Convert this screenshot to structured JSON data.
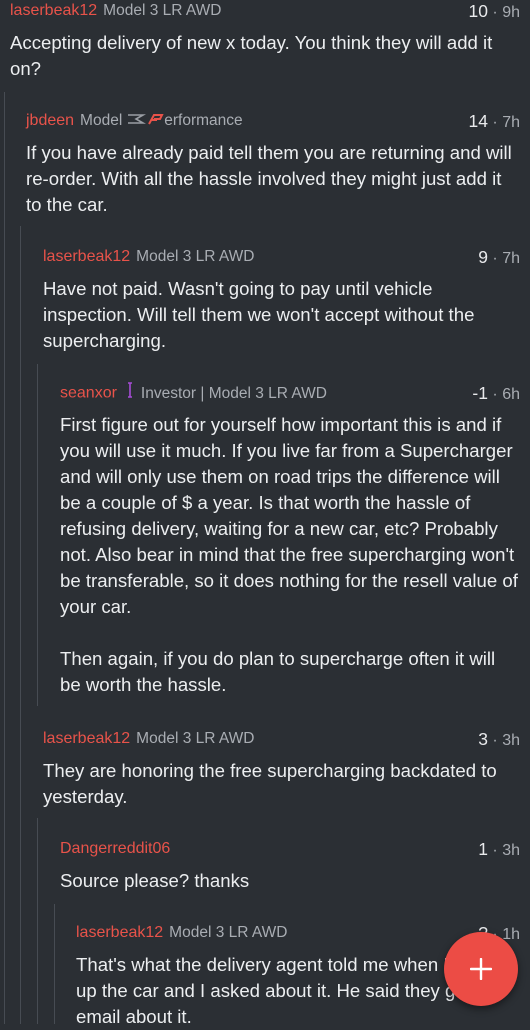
{
  "comments": [
    {
      "author": "laserbeak12",
      "flair": "Model 3 LR AWD",
      "score": "10",
      "time": "9h",
      "body": [
        "Accepting delivery of new x today. You think they will add it on?"
      ]
    },
    {
      "author": "jbdeen",
      "flair_prefix": "Model",
      "flair_suffix": "erformance",
      "score": "14",
      "time": "7h",
      "body": [
        "If you have already paid tell them you are returning and will re-order. With all the hassle involved they might just add it to the car."
      ]
    },
    {
      "author": "laserbeak12",
      "flair": "Model 3 LR AWD",
      "score": "9",
      "time": "7h",
      "body": [
        "Have not paid. Wasn't going to pay until vehicle inspection. Will tell them we won't accept without the supercharging."
      ]
    },
    {
      "author": "seanxor",
      "flair": "Investor | Model 3 LR AWD",
      "score": "-1",
      "time": "6h",
      "body": [
        "First figure out for yourself how important this is and if you will use it much. If you live far from a Supercharger and will only use them on road trips the difference will be a couple of $ a year. Is that worth the hassle of refusing delivery, waiting for a new car, etc? Probably not. Also bear in mind that the free supercharging won't be transferable, so it does nothing for the resell value of your car.",
        "Then again, if you do plan to supercharge often it will be worth the hassle."
      ]
    },
    {
      "author": "laserbeak12",
      "flair": "Model 3 LR AWD",
      "score": "3",
      "time": "3h",
      "body": [
        "They are honoring the free supercharging backdated to yesterday."
      ]
    },
    {
      "author": "Dangerreddit06",
      "flair": "",
      "score": "1",
      "time": "3h",
      "body": [
        "Source please? thanks"
      ]
    },
    {
      "author": "laserbeak12",
      "flair": "Model 3 LR AWD",
      "score": "?",
      "time": "1h",
      "body": [
        "That's what the delivery agent told me when I picked up the car and I asked about it. He said they got an email about it."
      ]
    }
  ],
  "separator": "·",
  "fab": {
    "icon": "plus-icon"
  },
  "colors": {
    "author": "#e8534a",
    "background": "#2b2f34",
    "fab": "#ec4c45"
  }
}
